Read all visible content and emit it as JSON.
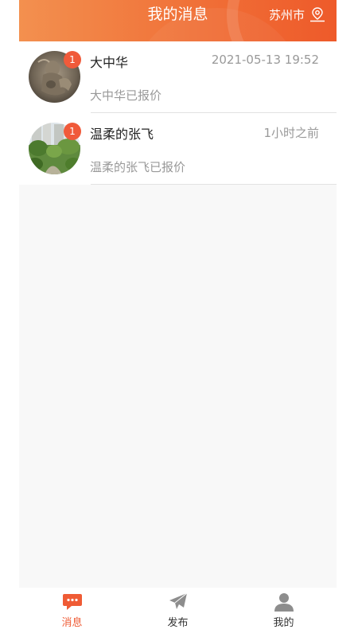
{
  "header": {
    "title": "我的消息",
    "city": "苏州市",
    "city_icon": "location-pin-icon",
    "accent_color": "#f06e36"
  },
  "messages": [
    {
      "name": "大中华",
      "time": "2021-05-13 19:52",
      "preview": "大中华已报价",
      "unread": "1",
      "avatar": "sculpture-photo"
    },
    {
      "name": "温柔的张飞",
      "time": "1小时之前",
      "preview": "温柔的张飞已报价",
      "unread": "1",
      "avatar": "garden-buildings-photo"
    }
  ],
  "tabbar": {
    "active_color": "#ef5b35",
    "tabs": [
      {
        "label": "消息",
        "icon": "chat-bubble-icon",
        "active": true
      },
      {
        "label": "发布",
        "icon": "paper-plane-icon",
        "active": false
      },
      {
        "label": "我的",
        "icon": "user-icon",
        "active": false
      }
    ]
  }
}
